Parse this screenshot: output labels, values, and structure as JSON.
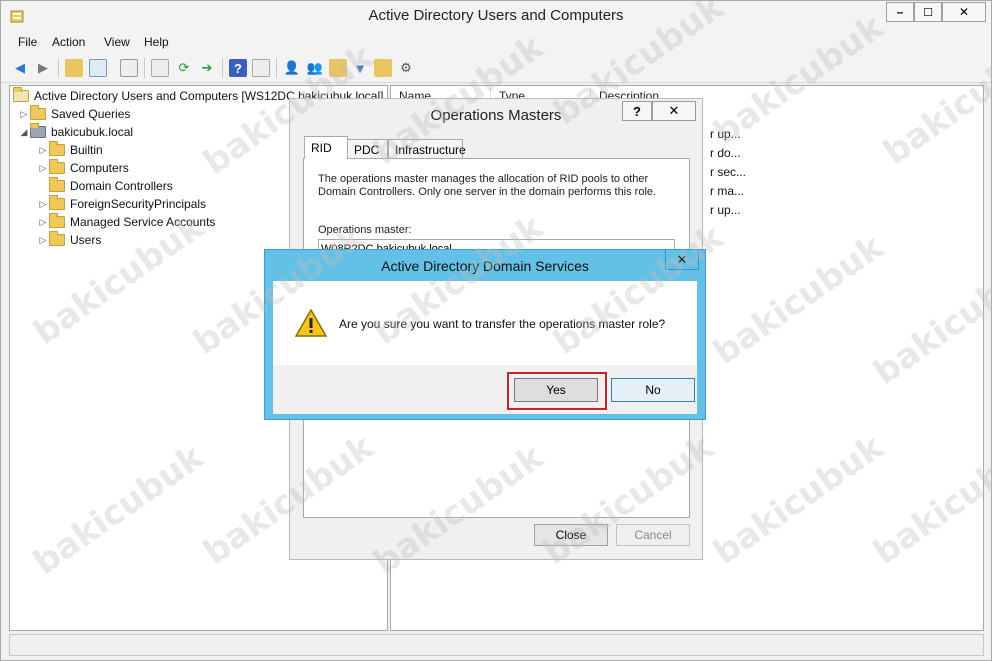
{
  "window": {
    "title": "Active Directory Users and Computers",
    "controls": {
      "minimize": "–",
      "maximize": "☐",
      "close": "✕"
    }
  },
  "menu": [
    "File",
    "Action",
    "View",
    "Help"
  ],
  "tree": {
    "root": "Active Directory Users and Computers [WS12DC.bakicubuk.local]",
    "items": [
      {
        "label": "Saved Queries"
      },
      {
        "label": "bakicubuk.local"
      },
      {
        "label": "Builtin"
      },
      {
        "label": "Computers"
      },
      {
        "label": "Domain Controllers"
      },
      {
        "label": "ForeignSecurityPrincipals"
      },
      {
        "label": "Managed Service Accounts"
      },
      {
        "label": "Users"
      }
    ]
  },
  "list": {
    "columns": [
      "Name",
      "Type",
      "Description"
    ],
    "description_fragments": [
      "r up...",
      "r do...",
      "r sec...",
      "r ma...",
      "r up..."
    ]
  },
  "ops_dialog": {
    "title": "Operations Masters",
    "help_btn": "?",
    "close_btn": "✕",
    "tabs": [
      "RID",
      "PDC",
      "Infrastructure"
    ],
    "active_tab": "RID",
    "description": "The operations master manages the allocation of RID pools to other Domain Controllers. Only one server in the domain performs this role.",
    "master_label": "Operations master:",
    "master_value": "W08R2DC.bakicubuk.local",
    "close_label": "Close",
    "cancel_label": "Cancel"
  },
  "confirm_dialog": {
    "title": "Active Directory Domain Services",
    "close_btn": "✕",
    "message": "Are you sure you want to transfer the operations master role?",
    "yes_label": "Yes",
    "no_label": "No",
    "icon": "warning-icon"
  },
  "watermark": "bakicubuk",
  "colors": {
    "dialog_accent": "#63c1e8",
    "highlight": "#c0262c",
    "folder": "#f0c85a"
  }
}
